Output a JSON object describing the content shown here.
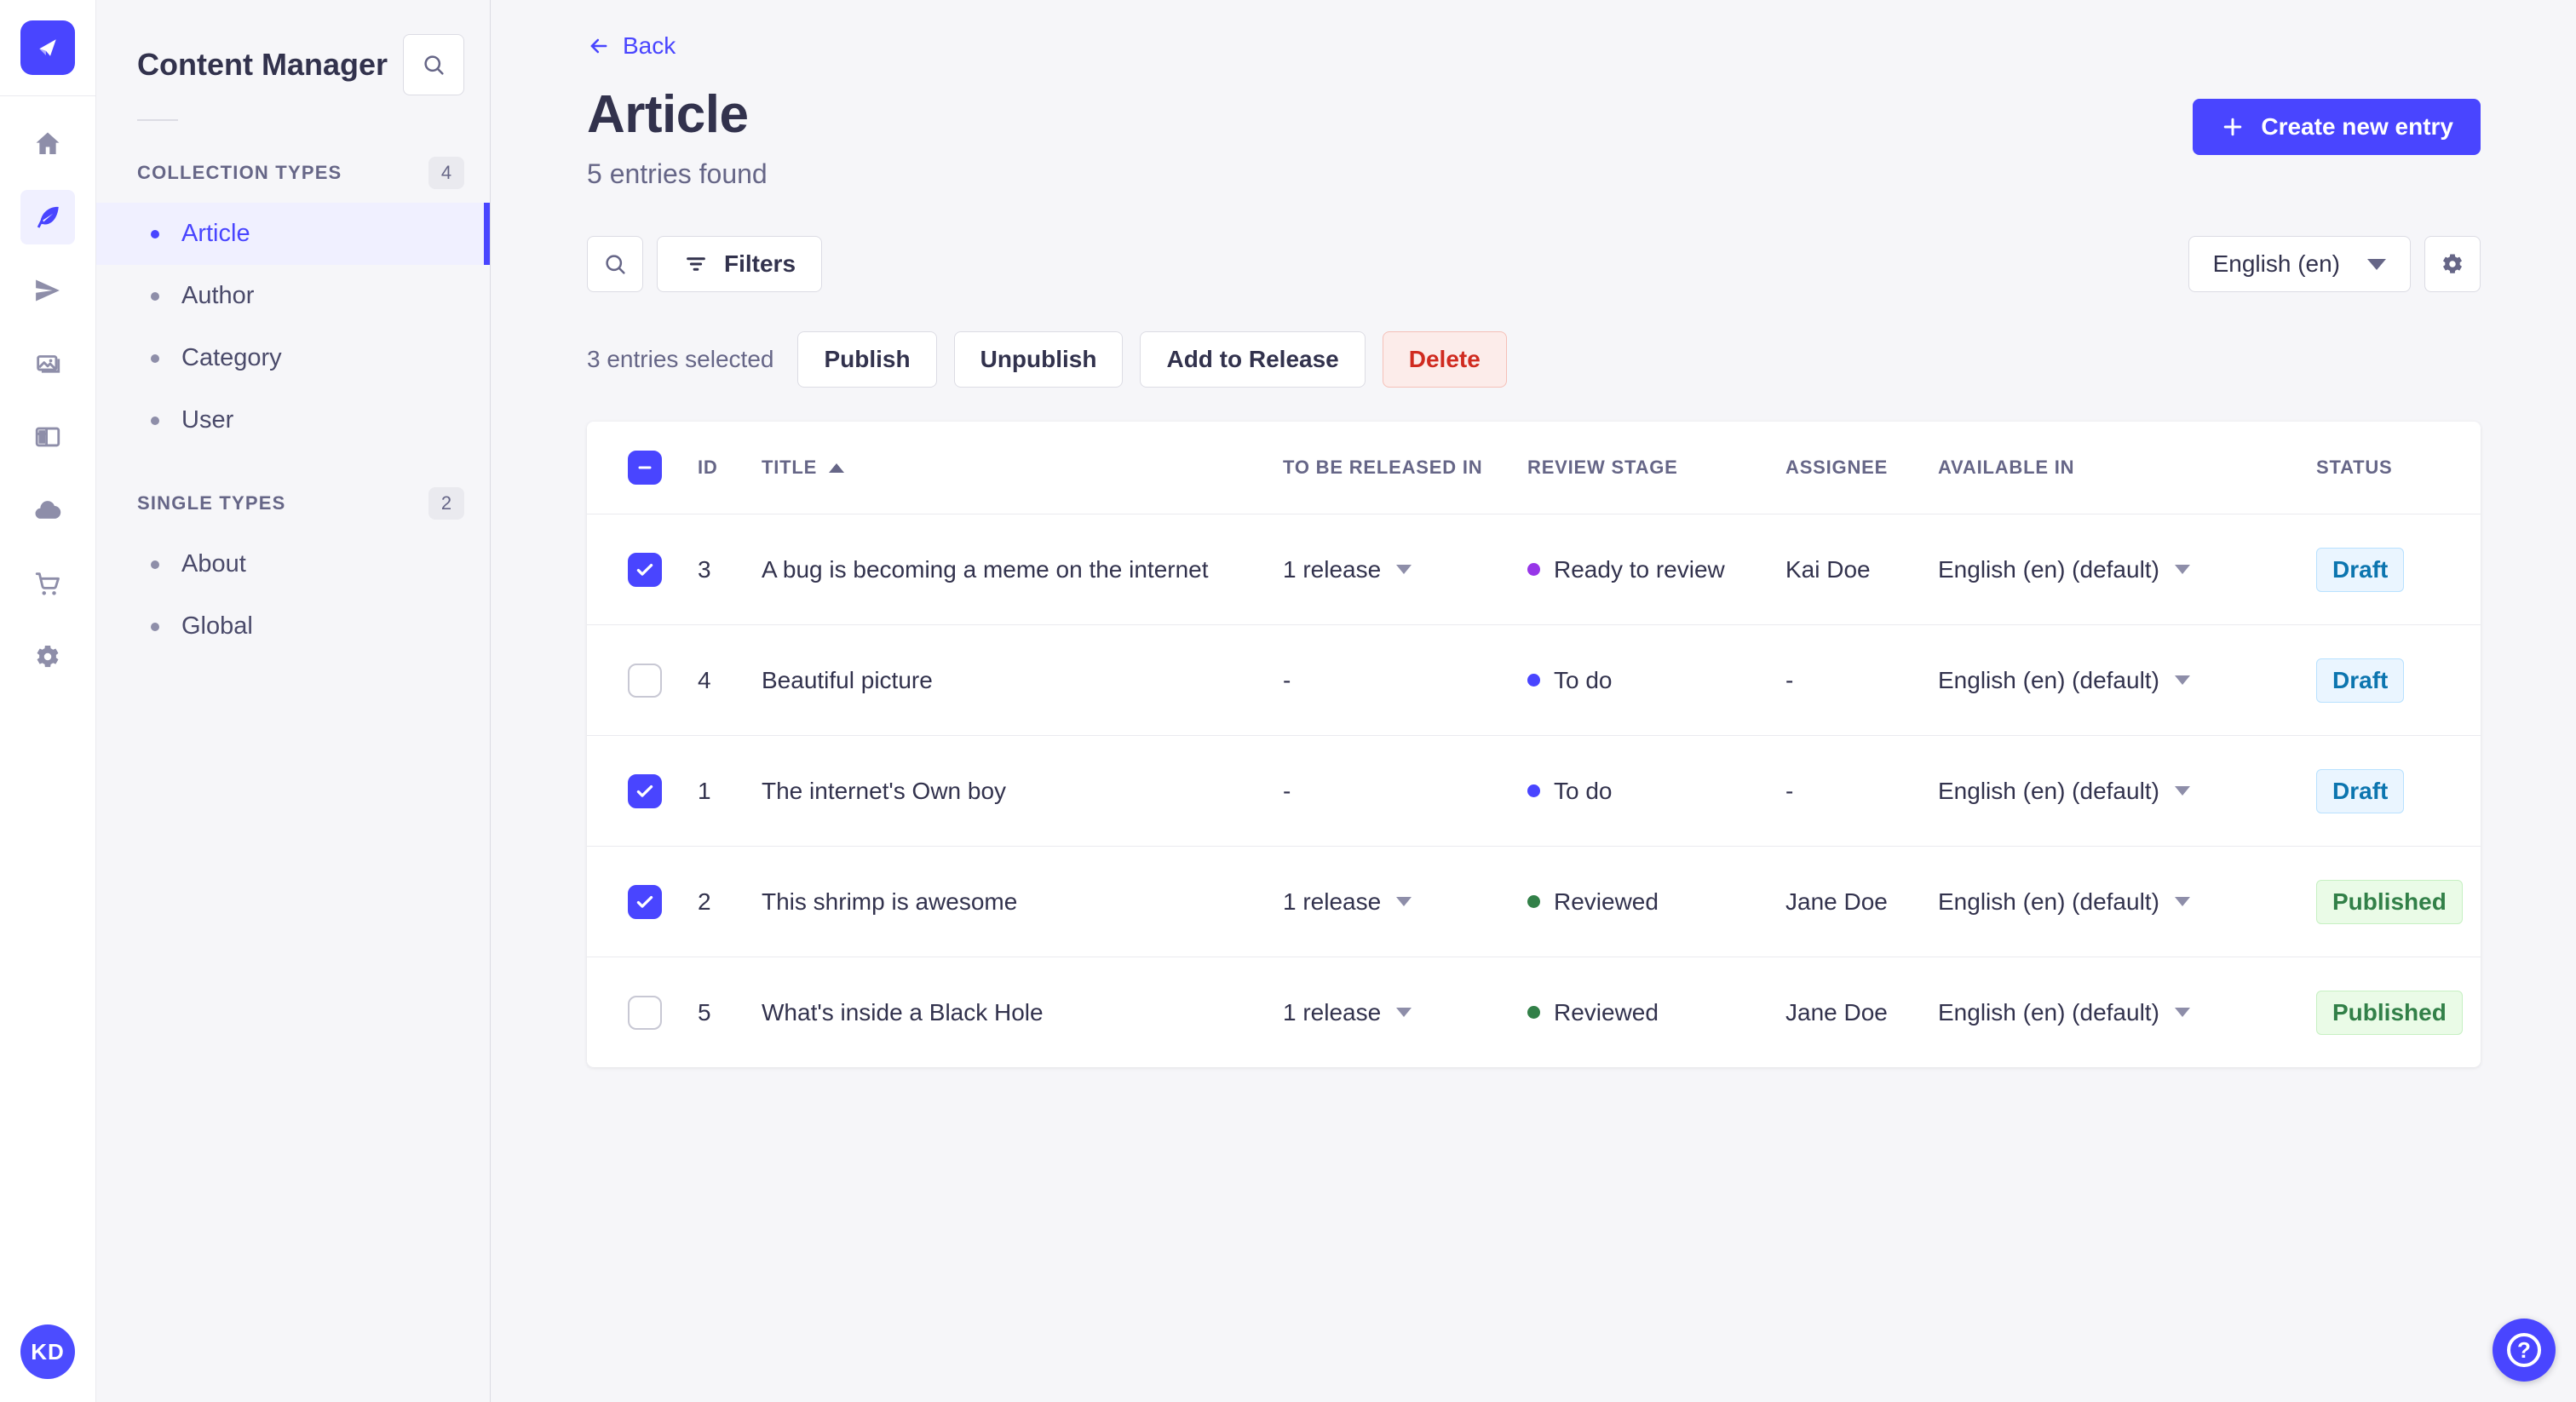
{
  "colors": {
    "primary": "#4945ff",
    "primary_bg": "#f0f0ff",
    "review_dots": {
      "purple": "#9736e8",
      "blue": "#4945ff",
      "green": "#328048"
    },
    "draft_text": "#0c75af",
    "published_text": "#328048",
    "delete_text": "#d02b20"
  },
  "subnav": {
    "title": "Content Manager",
    "sections": [
      {
        "label": "COLLECTION TYPES",
        "badge": "4",
        "items": [
          {
            "label": "Article",
            "active": true
          },
          {
            "label": "Author",
            "active": false
          },
          {
            "label": "Category",
            "active": false
          },
          {
            "label": "User",
            "active": false
          }
        ]
      },
      {
        "label": "SINGLE TYPES",
        "badge": "2",
        "items": [
          {
            "label": "About",
            "active": false
          },
          {
            "label": "Global",
            "active": false
          }
        ]
      }
    ]
  },
  "user": {
    "initials": "KD"
  },
  "header": {
    "back_label": "Back",
    "title": "Article",
    "subtitle": "5 entries found",
    "create_button": "Create new entry"
  },
  "toolbar": {
    "filters_label": "Filters",
    "locale_value": "English (en)"
  },
  "selection": {
    "text": "3 entries selected",
    "publish": "Publish",
    "unpublish": "Unpublish",
    "add_to_release": "Add to Release",
    "delete": "Delete"
  },
  "table": {
    "headers": {
      "id": "ID",
      "title": "TITLE",
      "released": "TO BE RELEASED IN",
      "review": "REVIEW STAGE",
      "assignee": "ASSIGNEE",
      "available": "AVAILABLE IN",
      "status": "STATUS"
    },
    "rows": [
      {
        "checked": true,
        "id": "3",
        "title": "A bug is becoming a meme on the internet",
        "released": "1 release",
        "review": "Ready to review",
        "review_color": "purple",
        "assignee": "Kai Doe",
        "available": "English (en) (default)",
        "status": "Draft"
      },
      {
        "checked": false,
        "id": "4",
        "title": "Beautiful picture",
        "released": "-",
        "review": "To do",
        "review_color": "blue",
        "assignee": "-",
        "available": "English (en) (default)",
        "status": "Draft"
      },
      {
        "checked": true,
        "id": "1",
        "title": "The internet's Own boy",
        "released": "-",
        "review": "To do",
        "review_color": "blue",
        "assignee": "-",
        "available": "English (en) (default)",
        "status": "Draft"
      },
      {
        "checked": true,
        "id": "2",
        "title": "This shrimp is awesome",
        "released": "1 release",
        "review": "Reviewed",
        "review_color": "green",
        "assignee": "Jane Doe",
        "available": "English (en) (default)",
        "status": "Published"
      },
      {
        "checked": false,
        "id": "5",
        "title": "What's inside a Black Hole",
        "released": "1 release",
        "review": "Reviewed",
        "review_color": "green",
        "assignee": "Jane Doe",
        "available": "English (en) (default)",
        "status": "Published"
      }
    ]
  }
}
